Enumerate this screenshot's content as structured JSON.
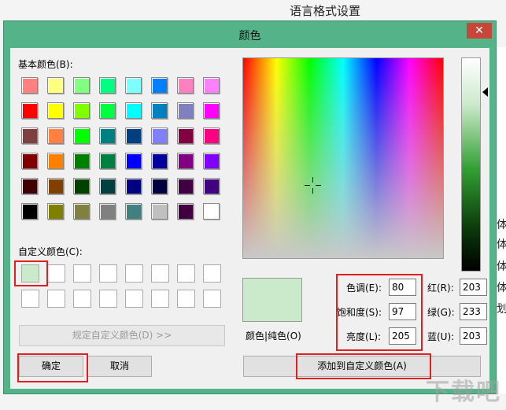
{
  "background": {
    "window_title": "语言格式设置",
    "side_chars": [
      "体",
      "体",
      "体",
      "体",
      "划"
    ],
    "watermark": "下载吧"
  },
  "dialog": {
    "title": "颜色",
    "close_symbol": "✕",
    "basic_colors_label": "基本颜色(B):",
    "custom_colors_label": "自定义颜色(C):",
    "define_custom_button": "规定自定义颜色(D) >>",
    "ok_button": "确定",
    "cancel_button": "取消",
    "color_solid_label": "颜色|纯色(O)",
    "add_custom_button": "添加到自定义颜色(A)",
    "hue_label": "色调(E):",
    "hue_value": "80",
    "sat_label": "饱和度(S):",
    "sat_value": "97",
    "lum_label": "亮度(L):",
    "lum_value": "205",
    "red_label": "红(R):",
    "red_value": "203",
    "green_label": "绿(G):",
    "green_value": "233",
    "blue_label": "蓝(U):",
    "blue_value": "203",
    "preview_color": "#cbe9cb",
    "highlight_color": "#e02020",
    "basic_colors": [
      [
        "#ff8080",
        "#ffff80",
        "#80ff80",
        "#00ff80",
        "#80ffff",
        "#0080ff",
        "#ff80c0",
        "#ff80ff"
      ],
      [
        "#ff0000",
        "#ffff00",
        "#80ff00",
        "#00ff40",
        "#00ffff",
        "#0080c0",
        "#8080c0",
        "#ff00ff"
      ],
      [
        "#804040",
        "#ff8040",
        "#00ff00",
        "#008080",
        "#004080",
        "#8080ff",
        "#800040",
        "#ff0080"
      ],
      [
        "#800000",
        "#ff8000",
        "#008000",
        "#008040",
        "#0000ff",
        "#0000a0",
        "#800080",
        "#8000ff"
      ],
      [
        "#400000",
        "#804000",
        "#004000",
        "#004040",
        "#000080",
        "#000040",
        "#400040",
        "#400080"
      ],
      [
        "#000000",
        "#808000",
        "#808040",
        "#808080",
        "#408080",
        "#c0c0c0",
        "#400040",
        "#ffffff"
      ]
    ],
    "custom_colors": [
      [
        "#cbe9cb",
        "#ffffff",
        "#ffffff",
        "#ffffff",
        "#ffffff",
        "#ffffff",
        "#ffffff",
        "#ffffff"
      ],
      [
        "#ffffff",
        "#ffffff",
        "#ffffff",
        "#ffffff",
        "#ffffff",
        "#ffffff",
        "#ffffff",
        "#ffffff"
      ]
    ]
  }
}
